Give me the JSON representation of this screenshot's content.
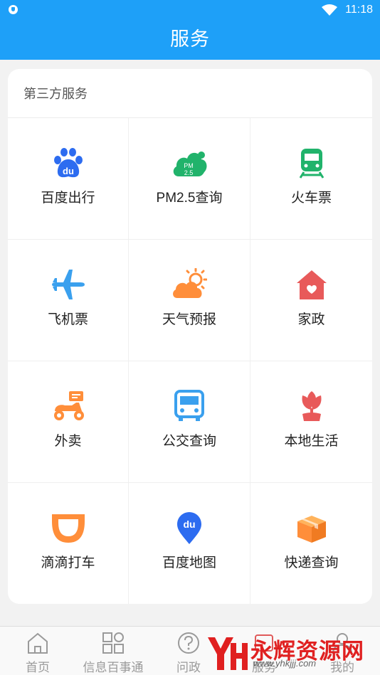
{
  "status_bar": {
    "time": "11:18"
  },
  "app_bar": {
    "title": "服务"
  },
  "section": {
    "title": "第三方服务",
    "items": [
      {
        "label": "百度出行",
        "icon": "baidu-paw-icon"
      },
      {
        "label": "PM2.5查询",
        "icon": "pm25-cloud-icon"
      },
      {
        "label": "火车票",
        "icon": "train-icon"
      },
      {
        "label": "飞机票",
        "icon": "airplane-icon"
      },
      {
        "label": "天气预报",
        "icon": "weather-sun-cloud-icon"
      },
      {
        "label": "家政",
        "icon": "house-heart-icon"
      },
      {
        "label": "外卖",
        "icon": "delivery-scooter-icon"
      },
      {
        "label": "公交查询",
        "icon": "bus-icon"
      },
      {
        "label": "本地生活",
        "icon": "tulip-icon"
      },
      {
        "label": "滴滴打车",
        "icon": "didi-icon"
      },
      {
        "label": "百度地图",
        "icon": "baidu-map-pin-icon"
      },
      {
        "label": "快递查询",
        "icon": "package-icon"
      }
    ]
  },
  "pm_badge": {
    "line1": "PM",
    "line2": "2.5"
  },
  "du_text": "du",
  "tabs": [
    {
      "label": "首页",
      "icon": "home-icon"
    },
    {
      "label": "信息百事通",
      "icon": "grid-icon"
    },
    {
      "label": "问政",
      "icon": "question-icon"
    },
    {
      "label": "服务",
      "icon": "service-icon"
    },
    {
      "label": "我的",
      "icon": "user-icon"
    }
  ],
  "watermark": {
    "brand": "永辉资源网",
    "url": "www.yhkjjj.com"
  },
  "colors": {
    "primary": "#1ea0f8",
    "baidu_blue": "#2d6cf0",
    "green": "#21b36b",
    "orange": "#ff8e3a",
    "red": "#e85a5a"
  }
}
